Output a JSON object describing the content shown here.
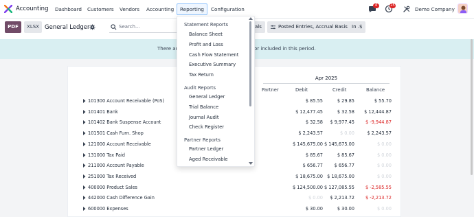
{
  "app": {
    "name": "Accounting",
    "menu": [
      "Dashboard",
      "Customers",
      "Vendors",
      "Accounting",
      "Reporting",
      "Configuration"
    ],
    "active_menu": "Reporting",
    "messages_badge": "4",
    "activity_badge": "25",
    "company": "Demo Company"
  },
  "toolbar": {
    "pdf_label": "PDF",
    "xlsx_label": "XLSX",
    "title": "General Ledger",
    "search_placeholder": "Search...",
    "filters": [
      "als",
      "Posted Entries, Accrual Basis",
      "In .$"
    ]
  },
  "banner": {
    "text_left": "There ar",
    "text_right": "or included in this period."
  },
  "report": {
    "period": "Apr 2025",
    "columns": [
      "Partner",
      "Debit",
      "Credit",
      "Balance"
    ],
    "rows": [
      {
        "account": "101300 Account Receivable (PoS)",
        "debit": "$ 85.55",
        "credit": "$ 29.85",
        "balance": "$ 55.70",
        "balance_state": "normal"
      },
      {
        "account": "101401 Bank",
        "debit": "$ 12,477.45",
        "credit": "$ 32.58",
        "balance": "$ 12,444.87",
        "balance_state": "normal"
      },
      {
        "account": "101402 Bank Suspense Account",
        "debit": "$ 32.58",
        "credit": "$ 9,977.45",
        "balance": "$ -9,944.87",
        "balance_state": "negative"
      },
      {
        "account": "101501 Cash Furn. Shop",
        "debit": "$ 2,243.57",
        "credit": "$ 0.00",
        "balance": "$ 2,243.57",
        "balance_state": "normal",
        "credit_state": "muted"
      },
      {
        "account": "121000 Account Receivable",
        "debit": "$ 145,675.00",
        "credit": "$ 145,675.00",
        "balance": "$ 0.00",
        "balance_state": "muted"
      },
      {
        "account": "131000 Tax Paid",
        "debit": "$ 85.67",
        "credit": "$ 85.67",
        "balance": "$ 0.00",
        "balance_state": "muted"
      },
      {
        "account": "211000 Account Payable",
        "debit": "$ 656.77",
        "credit": "$ 656.77",
        "balance": "$ 0.00",
        "balance_state": "muted"
      },
      {
        "account": "251000 Tax Received",
        "debit": "$ 18,675.00",
        "credit": "$ 18,675.00",
        "balance": "$ 0.00",
        "balance_state": "muted"
      },
      {
        "account": "400000 Product Sales",
        "debit": "$ 124,500.00",
        "credit": "$ 127,085.55",
        "balance": "$ -2,585.55",
        "balance_state": "negative"
      },
      {
        "account": "442000 Cash Difference Gain",
        "debit": "$ 0.00",
        "credit": "$ 2,213.72",
        "balance": "$ -2,213.72",
        "balance_state": "negative",
        "debit_state": "muted"
      },
      {
        "account": "600000 Expenses",
        "debit": "$ 30.00",
        "credit": "$ 30.00",
        "balance": "$ 0.00",
        "balance_state": "muted"
      }
    ]
  },
  "dropdown": {
    "groups": [
      {
        "title": "Statement Reports",
        "items": [
          "Balance Sheet",
          "Profit and Loss",
          "Cash Flow Statement",
          "Executive Summary",
          "Tax Return"
        ]
      },
      {
        "title": "Audit Reports",
        "items": [
          "General Ledger",
          "Trial Balance",
          "Journal Audit",
          "Check Register"
        ]
      },
      {
        "title": "Partner Reports",
        "items": [
          "Partner Ledger",
          "Aged Receivable"
        ]
      }
    ]
  },
  "colors": {
    "brand": "#714b67",
    "banner": "#d9eff2",
    "negative": "#dc2626",
    "badge": "#dc2626"
  }
}
